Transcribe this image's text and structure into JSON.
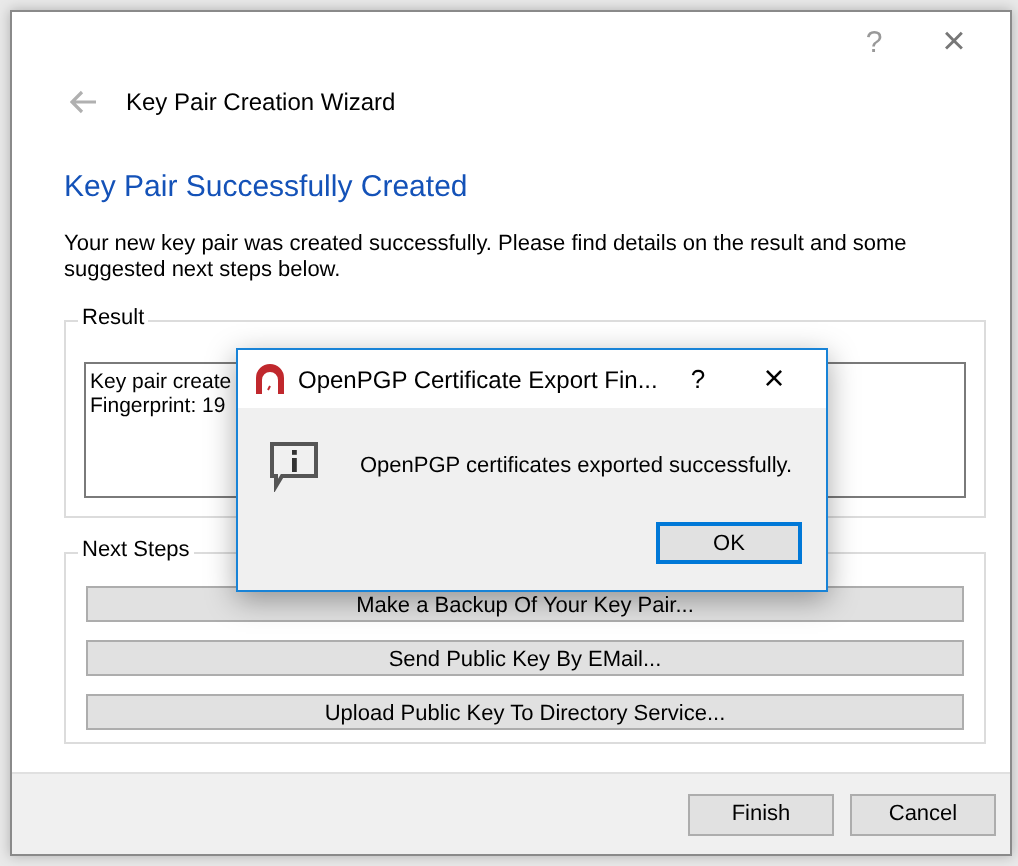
{
  "wizard": {
    "help_button": "?",
    "close_button": "×",
    "title": "Key Pair Creation Wizard",
    "heading": "Key Pair Successfully Created",
    "intro": "Your new key pair was created successfully. Please find details on the result and some suggested next steps below.",
    "result": {
      "label": "Result",
      "lines": [
        "Key pair create",
        "Fingerprint: 19"
      ]
    },
    "next_steps": {
      "label": "Next Steps",
      "buttons": [
        {
          "label": "Make a Backup Of Your Key Pair..."
        },
        {
          "label": "Send Public Key By EMail..."
        },
        {
          "label": "Upload Public Key To Directory Service..."
        }
      ]
    },
    "footer_buttons": [
      {
        "label": "Finish",
        "default": false
      },
      {
        "label": "Cancel",
        "default": false
      }
    ]
  },
  "dialog": {
    "title": "OpenPGP Certificate Export Fin...",
    "help_button": "?",
    "close_button": "×",
    "message": "OpenPGP certificates exported successfully.",
    "buttons": [
      {
        "label": "OK",
        "default": true
      }
    ]
  }
}
